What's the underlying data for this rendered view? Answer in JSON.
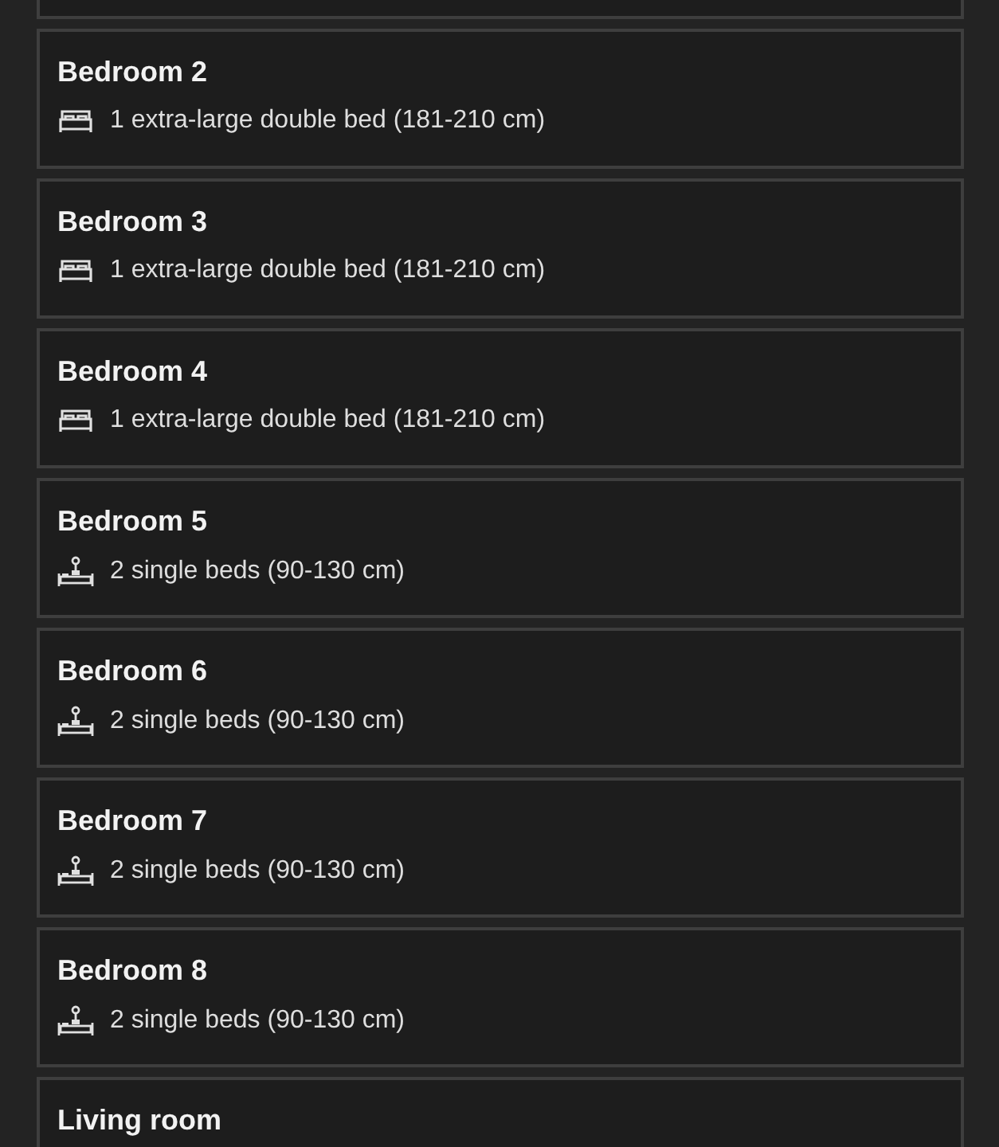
{
  "rooms": [
    {
      "name": "Bedroom 2",
      "beds": {
        "kind": "double",
        "text": "1 extra-large double bed (181-210 cm)"
      }
    },
    {
      "name": "Bedroom 3",
      "beds": {
        "kind": "double",
        "text": "1 extra-large double bed (181-210 cm)"
      }
    },
    {
      "name": "Bedroom 4",
      "beds": {
        "kind": "double",
        "text": "1 extra-large double bed (181-210 cm)"
      }
    },
    {
      "name": "Bedroom 5",
      "beds": {
        "kind": "single",
        "text": "2 single beds (90-130 cm)"
      }
    },
    {
      "name": "Bedroom 6",
      "beds": {
        "kind": "single",
        "text": "2 single beds (90-130 cm)"
      }
    },
    {
      "name": "Bedroom 7",
      "beds": {
        "kind": "single",
        "text": "2 single beds (90-130 cm)"
      }
    },
    {
      "name": "Bedroom 8",
      "beds": {
        "kind": "single",
        "text": "2 single beds (90-130 cm)"
      }
    },
    {
      "name": "Living room"
    }
  ]
}
